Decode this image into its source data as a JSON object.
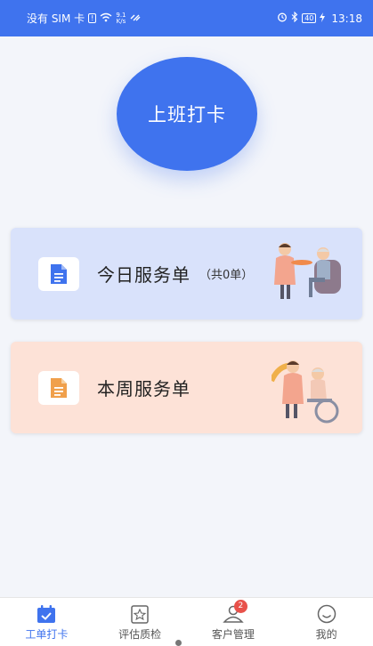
{
  "status_bar": {
    "carrier": "没有 SIM 卡",
    "sim_alert": "!",
    "net_speed_value": "9.1",
    "net_speed_unit": "K/s",
    "battery": "40",
    "time": "13:18"
  },
  "clock_in": {
    "label": "上班打卡"
  },
  "cards": {
    "today": {
      "title": "今日服务单",
      "count": "（共0单）"
    },
    "week": {
      "title": "本周服务单"
    }
  },
  "tabs": [
    {
      "label": "工单打卡",
      "icon": "calendar-check-icon",
      "active": true
    },
    {
      "label": "评估质检",
      "icon": "star-card-icon"
    },
    {
      "label": "客户管理",
      "icon": "user-icon",
      "badge": "2"
    },
    {
      "label": "我的",
      "icon": "smile-icon"
    }
  ],
  "colors": {
    "primary": "#3f73ee",
    "today_card": "#d9e2fb",
    "week_card": "#fde2d7",
    "badge": "#e8514a"
  }
}
